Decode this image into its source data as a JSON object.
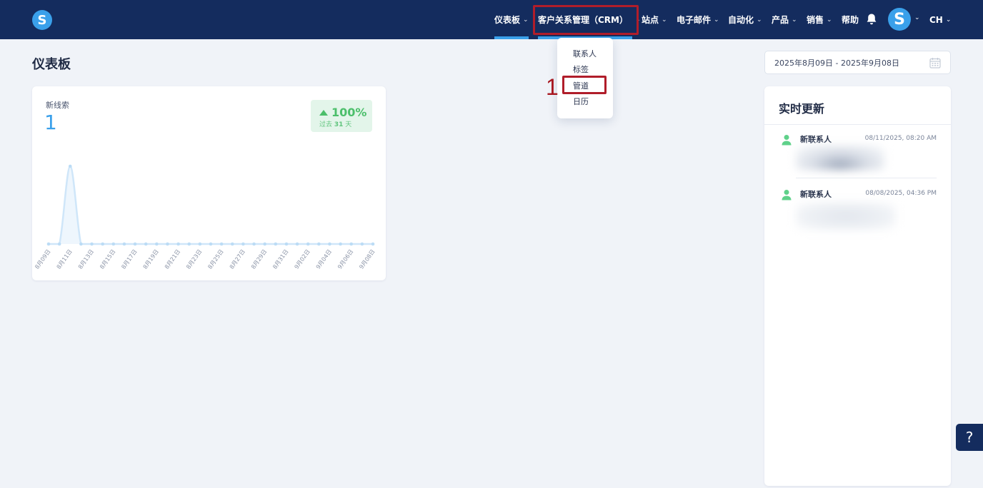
{
  "app": {
    "logo_letter": "S"
  },
  "nav": {
    "items": [
      {
        "label": "仪表板"
      },
      {
        "label": "客户关系管理（CRM）"
      },
      {
        "label": "站点"
      },
      {
        "label": "电子邮件"
      },
      {
        "label": "自动化"
      },
      {
        "label": "产品"
      },
      {
        "label": "销售"
      },
      {
        "label": "帮助"
      }
    ],
    "avatar_letter": "S",
    "language": "CH"
  },
  "crm_menu": {
    "items": [
      "联系人",
      "标签",
      "管道",
      "日历"
    ]
  },
  "annotation": {
    "step": "1"
  },
  "page": {
    "title": "仪表板"
  },
  "date_range": {
    "value": "2025年8月09日 - 2025年9月08日"
  },
  "stat_card": {
    "label": "新线索",
    "value": "1",
    "trend_percent": "100%",
    "trend_prefix": "过去",
    "trend_days": "31",
    "trend_suffix": "天"
  },
  "chart_data": {
    "type": "area",
    "x": [
      "8月09日",
      "8月10日",
      "8月11日",
      "8月12日",
      "8月13日",
      "8月14日",
      "8月15日",
      "8月16日",
      "8月17日",
      "8月18日",
      "8月19日",
      "8月20日",
      "8月21日",
      "8月22日",
      "8月23日",
      "8月24日",
      "8月25日",
      "8月26日",
      "8月27日",
      "8月28日",
      "8月29日",
      "8月30日",
      "8月31日",
      "9月01日",
      "9月02日",
      "9月03日",
      "9月04日",
      "9月05日",
      "9月06日",
      "9月07日",
      "9月08日"
    ],
    "tick_labels": [
      "8月09日",
      "8月11日",
      "8月13日",
      "8月15日",
      "8月17日",
      "8月19日",
      "8月21日",
      "8月23日",
      "8月25日",
      "8月27日",
      "8月29日",
      "8月31日",
      "9月02日",
      "9月04日",
      "9月06日",
      "9月08日"
    ],
    "values": [
      0,
      0,
      1,
      0,
      0,
      0,
      0,
      0,
      0,
      0,
      0,
      0,
      0,
      0,
      0,
      0,
      0,
      0,
      0,
      0,
      0,
      0,
      0,
      0,
      0,
      0,
      0,
      0,
      0,
      0,
      0
    ],
    "ylim": [
      0,
      1
    ],
    "grid": false,
    "color": "#cfe6f9",
    "point_color": "#bcdcf5"
  },
  "live_updates": {
    "title": "实时更新",
    "items": [
      {
        "title": "新联系人",
        "time": "08/11/2025, 08:20 AM"
      },
      {
        "title": "新联系人",
        "time": "08/08/2025, 04:36 PM"
      }
    ]
  },
  "help": {
    "label": "?"
  },
  "colors": {
    "nav_bg": "#142c5e",
    "accent": "#3aa0ea",
    "highlight": "#b01d2a",
    "trend_green": "#4cbf6b"
  }
}
